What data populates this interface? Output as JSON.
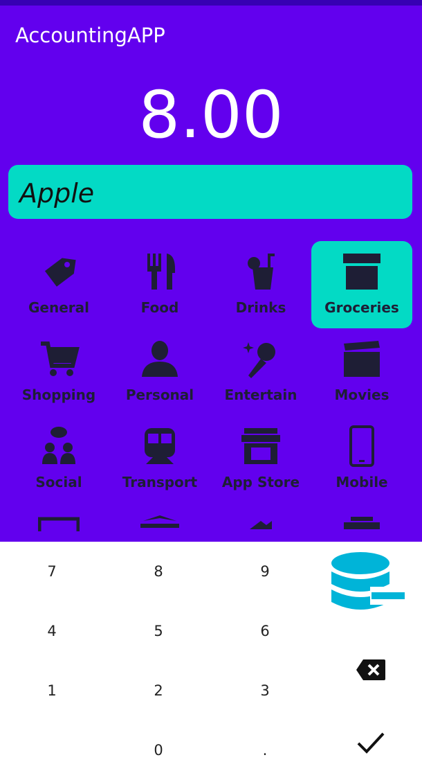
{
  "app": {
    "title": "AccountingAPP"
  },
  "amount": {
    "value": "8.00"
  },
  "note": {
    "value": "Apple"
  },
  "categories": [
    {
      "label": "General",
      "icon": "tag-icon"
    },
    {
      "label": "Food",
      "icon": "fork-knife-icon"
    },
    {
      "label": "Drinks",
      "icon": "drink-icon"
    },
    {
      "label": "Groceries",
      "icon": "archive-box-icon",
      "selected": true
    },
    {
      "label": "Shopping",
      "icon": "shopping-cart-icon"
    },
    {
      "label": "Personal",
      "icon": "person-icon"
    },
    {
      "label": "Entertain",
      "icon": "microphone-icon"
    },
    {
      "label": "Movies",
      "icon": "clapperboard-icon"
    },
    {
      "label": "Social",
      "icon": "people-chat-icon"
    },
    {
      "label": "Transport",
      "icon": "train-icon"
    },
    {
      "label": "App Store",
      "icon": "storefront-icon"
    },
    {
      "label": "Mobile",
      "icon": "smartphone-icon"
    }
  ],
  "keypad": {
    "keys": [
      "7",
      "8",
      "9",
      "4",
      "5",
      "6",
      "1",
      "2",
      "3",
      "",
      "0",
      "."
    ],
    "side": {
      "db_icon": "database-remove-icon",
      "backspace_icon": "backspace-icon",
      "confirm_icon": "checkmark-icon"
    }
  },
  "colors": {
    "primary": "#6200EE",
    "primary_dark": "#3700B3",
    "accent": "#03DAC5",
    "icon": "#1E1E35",
    "db_icon": "#00B4D8"
  }
}
